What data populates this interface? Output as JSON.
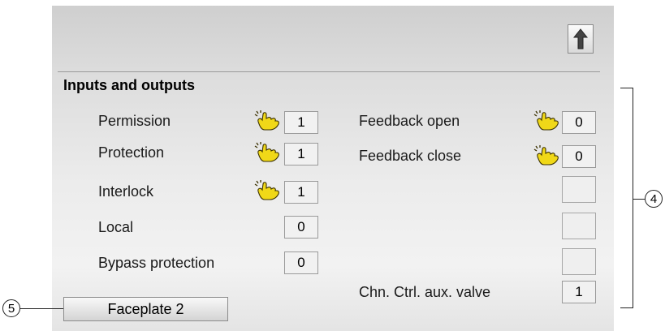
{
  "section_title": "Inputs and outputs",
  "left_rows": [
    {
      "label": "Permission",
      "value": "1",
      "icon": "hand-icon"
    },
    {
      "label": "Protection",
      "value": "1",
      "icon": "hand-icon"
    },
    {
      "label": "Interlock",
      "value": "1",
      "icon": "hand-icon"
    },
    {
      "label": "Local",
      "value": "0"
    },
    {
      "label": "Bypass protection",
      "value": "0"
    }
  ],
  "right_rows": [
    {
      "label": "Feedback open",
      "value": "0",
      "icon": "hand-icon"
    },
    {
      "label": "Feedback close",
      "value": "0",
      "icon": "hand-icon"
    },
    {
      "label": "",
      "value": ""
    },
    {
      "label": "",
      "value": ""
    },
    {
      "label": "",
      "value": ""
    },
    {
      "label": "Chn. Ctrl. aux. valve",
      "value": "1"
    }
  ],
  "faceplate_button": "Faceplate 2",
  "callouts": {
    "bracket": "4",
    "button": "5"
  },
  "up_button_icon": "arrow-up-icon",
  "colors": {
    "hand_icon": "#f0d818",
    "panel_bg": "#e6e6e6",
    "value_box": "#f1f1f1"
  }
}
